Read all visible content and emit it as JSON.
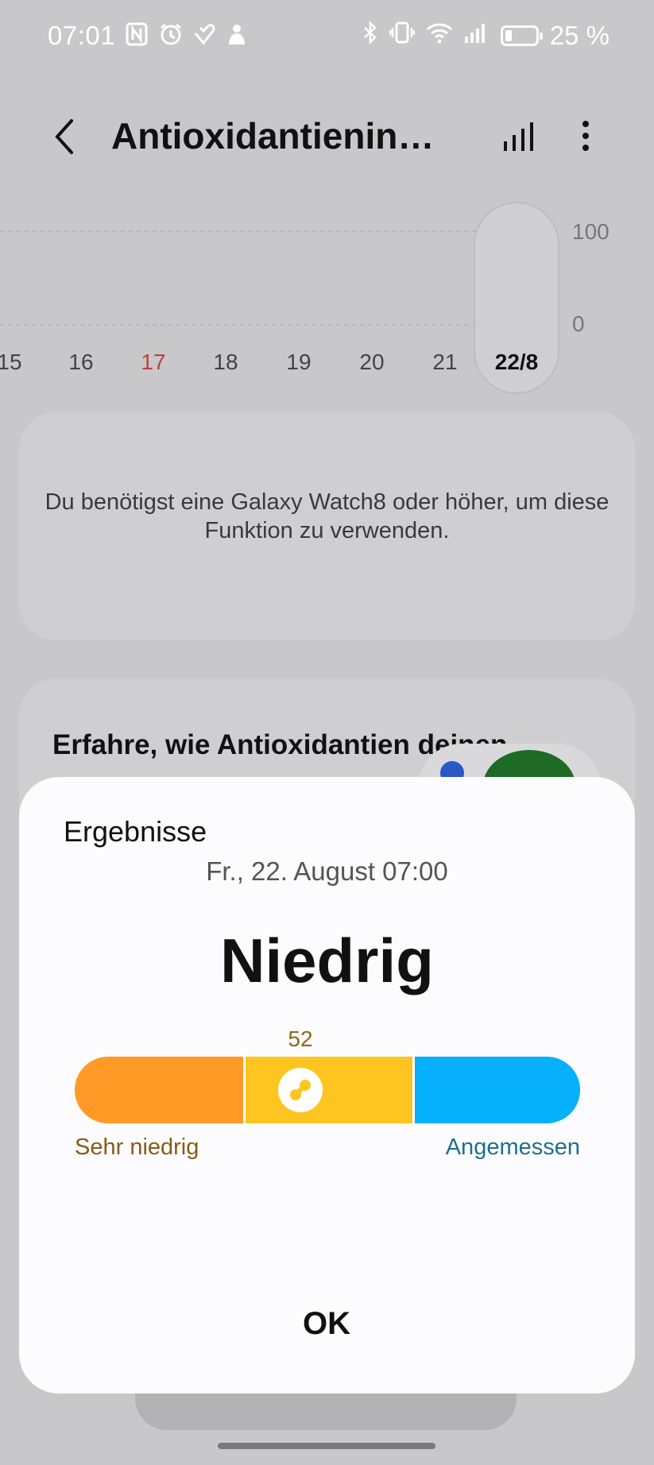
{
  "status_bar": {
    "time": "07:01",
    "battery_text": "25 %",
    "left_icons": [
      "nfc-icon",
      "alarm-icon",
      "health-icon",
      "notification-icon"
    ],
    "right_icons": [
      "bluetooth-icon",
      "vibrate-icon",
      "wifi-icon",
      "signal-icon",
      "battery-icon"
    ]
  },
  "header": {
    "title": "Antioxidantienin…",
    "back_icon": "back-arrow-icon",
    "chart_icon": "bar-chart-icon",
    "more_icon": "more-vertical-icon"
  },
  "trend_chart": {
    "y_labels": [
      "100",
      "0"
    ],
    "x_labels": [
      "15",
      "16",
      "17",
      "18",
      "19",
      "20",
      "21",
      "22/8"
    ],
    "highlighted_label": "17",
    "selected_label": "22/8"
  },
  "info_card": {
    "text": "Du benötigst eine Galaxy Watch8 oder höher, um diese Funktion zu verwenden."
  },
  "learn_card": {
    "title": "Erfahre, wie Antioxidantien deinen"
  },
  "results_dialog": {
    "title": "Ergebnisse",
    "date": "Fr., 22. August 07:00",
    "level": "Niedrig",
    "score": "52",
    "score_fraction": 0.4,
    "label_low": "Sehr niedrig",
    "label_high": "Angemessen",
    "ok_label": "OK",
    "colors": {
      "very_low": "#ff9a26",
      "low": "#fec520",
      "adequate": "#06b0fa"
    }
  }
}
